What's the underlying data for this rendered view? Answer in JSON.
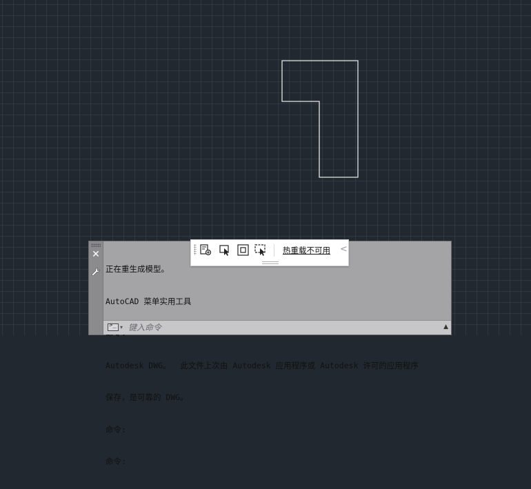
{
  "canvas": {
    "background": "#212830",
    "grid": true,
    "geometry_color": "#e6e6e6"
  },
  "floating_toolbar": {
    "buttons": [
      {
        "name": "insert-block-icon"
      },
      {
        "name": "select-object-icon"
      },
      {
        "name": "rectangle-select-icon"
      },
      {
        "name": "window-select-icon"
      }
    ],
    "hot_reload_label": "热重载不可用",
    "collapse_glyph": "<"
  },
  "command_line": {
    "close_glyph": "✕",
    "history": [
      "正在重生成模型。",
      "AutoCAD 菜单实用工具",
      "命令:",
      "Autodesk DWG。  此文件上次由 Autodesk 应用程序或 Autodesk 许可的应用程序",
      "保存，是可靠的 DWG。",
      "命令:",
      "命令:"
    ],
    "prompt_glyph": ">_",
    "dropdown_glyph": "▾",
    "input_placeholder": "键入命令",
    "input_value": "",
    "scroll_glyph": "▲"
  }
}
